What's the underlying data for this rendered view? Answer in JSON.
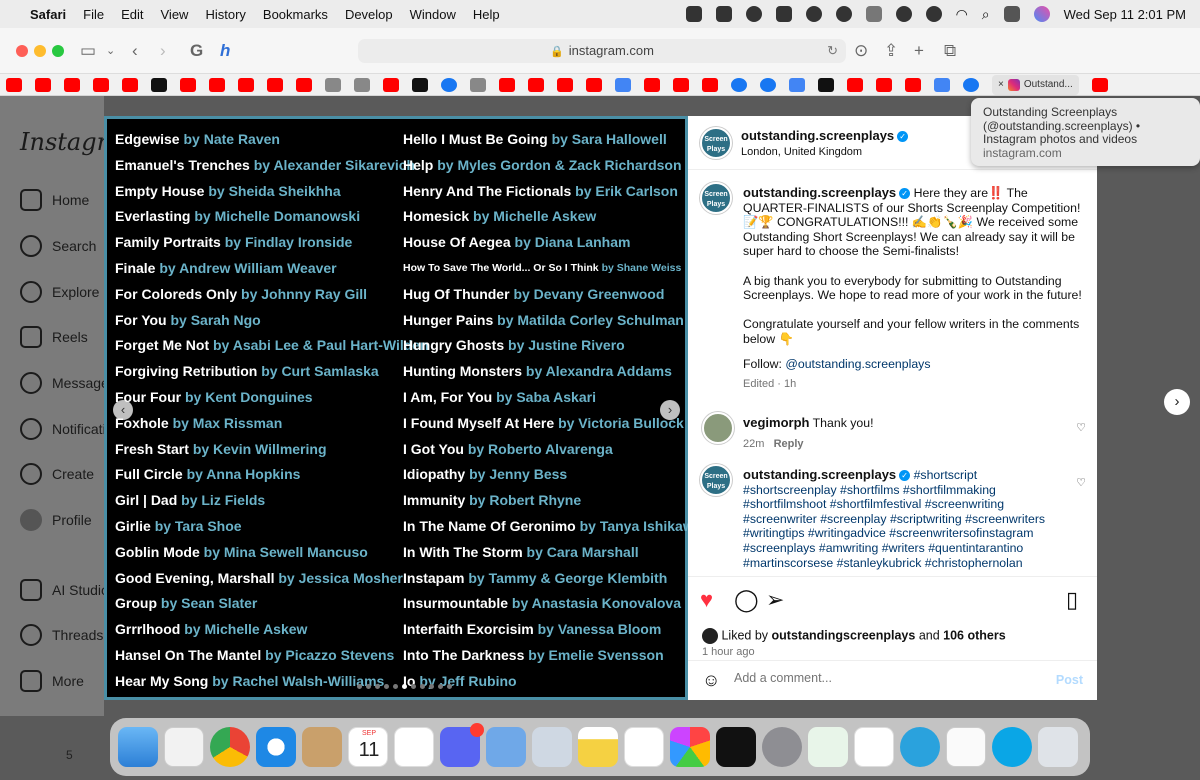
{
  "menubar": {
    "app": "Safari",
    "items": [
      "File",
      "Edit",
      "View",
      "History",
      "Bookmarks",
      "Develop",
      "Window",
      "Help"
    ],
    "clock": "Wed Sep 11  2:01 PM"
  },
  "browser": {
    "url": "instagram.com",
    "active_tab_label": "Outstand..."
  },
  "tooltip": {
    "line1": "Outstanding Screenplays",
    "line2": "(@outstanding.screenplays) •",
    "line3": "Instagram photos and videos",
    "domain": "instagram.com"
  },
  "sidebar": {
    "logo": "Instagram",
    "items": [
      {
        "label": "Home",
        "icon": "home-icon"
      },
      {
        "label": "Search",
        "icon": "search-icon"
      },
      {
        "label": "Explore",
        "icon": "explore-icon"
      },
      {
        "label": "Reels",
        "icon": "reels-icon"
      },
      {
        "label": "Messages",
        "icon": "messenger-icon"
      },
      {
        "label": "Notifications",
        "icon": "heart-icon"
      },
      {
        "label": "Create",
        "icon": "plus-icon"
      },
      {
        "label": "Profile",
        "icon": "avatar-icon"
      },
      {
        "label": "AI Studio",
        "icon": "ai-studio-icon"
      },
      {
        "label": "Threads",
        "icon": "threads-icon"
      },
      {
        "label": "More",
        "icon": "menu-icon"
      }
    ]
  },
  "image_list": {
    "left": [
      {
        "title": "Edgewise",
        "by": "by Nate Raven"
      },
      {
        "title": "Emanuel's Trenches",
        "by": "by Alexander Sikarevich"
      },
      {
        "title": "Empty House",
        "by": "by Sheida Sheikhha"
      },
      {
        "title": "Everlasting",
        "by": "by Michelle Domanowski"
      },
      {
        "title": "Family Portraits",
        "by": "by Findlay Ironside"
      },
      {
        "title": "Finale",
        "by": "by Andrew William Weaver"
      },
      {
        "title": "For Coloreds Only",
        "by": "by Johnny Ray Gill"
      },
      {
        "title": "For You",
        "by": "by Sarah Ngo"
      },
      {
        "title": "Forget Me Not",
        "by": "by Asabi Lee & Paul Hart-Wilden"
      },
      {
        "title": "Forgiving Retribution",
        "by": "by Curt Samlaska"
      },
      {
        "title": "Four Four",
        "by": "by Kent Donguines"
      },
      {
        "title": "Foxhole",
        "by": "by Max Rissman"
      },
      {
        "title": "Fresh Start",
        "by": "by Kevin Willmering"
      },
      {
        "title": "Full Circle",
        "by": "by Anna Hopkins"
      },
      {
        "title": "Girl | Dad",
        "by": "by Liz Fields"
      },
      {
        "title": "Girlie",
        "by": "by Tara Shoe"
      },
      {
        "title": "Goblin Mode",
        "by": "by Mina Sewell Mancuso"
      },
      {
        "title": "Good Evening, Marshall",
        "by": "by Jessica Mosher"
      },
      {
        "title": "Group",
        "by": "by Sean Slater"
      },
      {
        "title": "Grrrlhood",
        "by": "by Michelle Askew"
      },
      {
        "title": "Hansel On The Mantel",
        "by": "by Picazzo Stevens"
      },
      {
        "title": "Hear My Song",
        "by": "by Rachel Walsh-Williams"
      }
    ],
    "right": [
      {
        "title": "Hello I Must Be Going",
        "by": "by Sara Hallowell"
      },
      {
        "title": "Help",
        "by": "by Myles Gordon & Zack Richardson"
      },
      {
        "title": "Henry And The Fictionals",
        "by": "by Erik Carlson"
      },
      {
        "title": "Homesick",
        "by": "by Michelle Askew"
      },
      {
        "title": "House Of Aegea",
        "by": "by Diana Lanham"
      },
      {
        "title": "How To Save The World... Or So I Think",
        "by": "by Shane Weiss",
        "small": true
      },
      {
        "title": "Hug Of Thunder",
        "by": "by Devany Greenwood"
      },
      {
        "title": "Hunger Pains",
        "by": "by Matilda Corley Schulman"
      },
      {
        "title": "Hungry Ghosts",
        "by": "by Justine Rivero"
      },
      {
        "title": "Hunting Monsters",
        "by": "by Alexandra Addams"
      },
      {
        "title": "I Am, For You",
        "by": "by Saba Askari"
      },
      {
        "title": "I Found Myself At Here",
        "by": "by Victoria Bullock"
      },
      {
        "title": "I Got You",
        "by": "by Roberto Alvarenga"
      },
      {
        "title": "Idiopathy",
        "by": "by Jenny Bess"
      },
      {
        "title": "Immunity",
        "by": "by Robert Rhyne"
      },
      {
        "title": "In The Name Of Geronimo",
        "by": "by Tanya Ishikawa"
      },
      {
        "title": "In With The Storm",
        "by": "by Cara Marshall"
      },
      {
        "title": "Instapam",
        "by": "by Tammy & George Klembith"
      },
      {
        "title": "Insurmountable",
        "by": "by Anastasia Konovalova"
      },
      {
        "title": "Interfaith Exorcisim",
        "by": "by Vanessa Bloom"
      },
      {
        "title": "Into The Darkness",
        "by": "by Emelie Svensson"
      },
      {
        "title": "Io",
        "by": "by Jeff Rubino"
      }
    ]
  },
  "post": {
    "username": "outstanding.screenplays",
    "location": "London, United Kingdom",
    "avatar_text": "Outstanding Screen Plays",
    "caption_p1": "Here they are‼️ The QUARTER-FINALISTS of our Shorts Screenplay Competition! 📝🏆 CONGRATULATIONS!!! ✍️👏🍾🎉 We received some Outstanding Short Screenplays! We can already say it will be super hard to choose the Semi-finalists!",
    "caption_p2": "A big thank you to everybody for submitting to Outstanding Screenplays. We hope to read more of your work in the future!",
    "caption_p3": "Congratulate yourself and your fellow writers in the comments below 👇",
    "follow_label": "Follow:",
    "follow_handle": "@outstanding.screenplays",
    "edited": "Edited · 1h",
    "comment1_user": "vegimorph",
    "comment1_text": "Thank you!",
    "comment1_time": "22m",
    "reply_label": "Reply",
    "hashtags": "#shortscript #shortscreenplay #shortfilms #shortfilmmaking #shortfilmshoot #shortfilmfestival #screenwriting #screenwriter #screenplay #scriptwriting #screenwriters #writingtips #writingadvice #screenwritersofinstagram #screenplays #amwriting #writers #quentintarantino #martinscorsese #stanleykubrick #christophernolan #gretagerwig #scriptwriter",
    "liked_by_prefix": "Liked by",
    "liked_by_user": "outstandingscreenplays",
    "liked_by_and": "and",
    "liked_by_others": "106 others",
    "time_ago": "1 hour ago",
    "comment_placeholder": "Add a comment...",
    "post_button": "Post"
  },
  "dock": {
    "calendar_month": "SEP",
    "calendar_day": "11"
  },
  "background": {
    "page_number": "5"
  },
  "colors": {
    "accent_blue": "#0095f6",
    "like_red": "#ff3040",
    "name_teal": "#6bb3c9"
  }
}
